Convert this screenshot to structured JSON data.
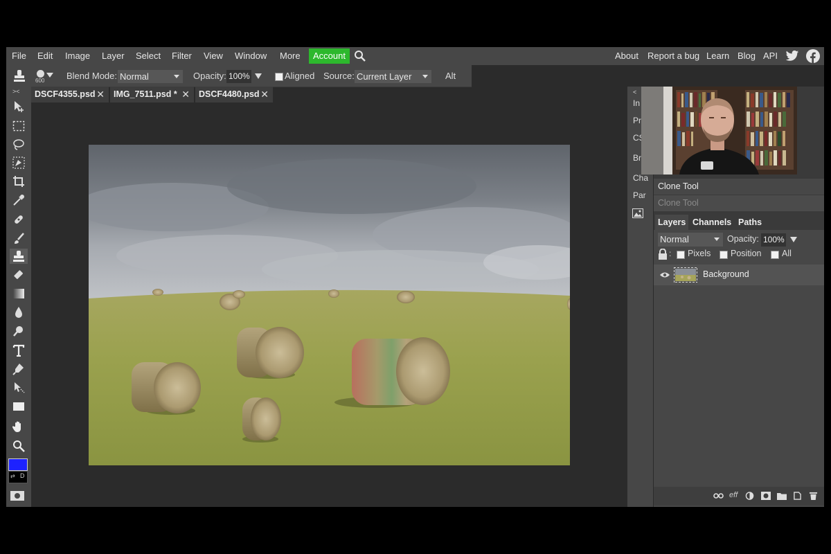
{
  "menu": {
    "items": [
      "File",
      "Edit",
      "Image",
      "Layer",
      "Select",
      "Filter",
      "View",
      "Window",
      "More"
    ],
    "account": "Account",
    "right_links": [
      "About",
      "Report a bug",
      "Learn",
      "Blog",
      "API"
    ],
    "icons": [
      "search-icon",
      "twitter-icon",
      "facebook-icon"
    ]
  },
  "options": {
    "brush_size": "600",
    "blend_label": "Blend Mode:",
    "blend_value": "Normal",
    "opacity_label": "Opacity:",
    "opacity_value": "100%",
    "aligned_label": "Aligned",
    "source_label": "Source:",
    "source_value": "Current Layer",
    "alt_label": "Alt"
  },
  "tabs": [
    {
      "label": "DSCF4355.psd"
    },
    {
      "label": "IMG_7511.psd *"
    },
    {
      "label": "DSCF4480.psd"
    }
  ],
  "mini_panel": {
    "labels": [
      "In",
      "Pr",
      "CS",
      "Br",
      "Cha",
      "Par"
    ]
  },
  "history": {
    "items": [
      "Clone Tool",
      "Clone Tool"
    ]
  },
  "layers_panel": {
    "tabs": [
      "Layers",
      "Channels",
      "Paths"
    ],
    "blend_value": "Normal",
    "opacity_label": "Opacity:",
    "opacity_value": "100%",
    "lock_pixels": "Pixels",
    "lock_position": "Position",
    "lock_all": "All",
    "layers": [
      {
        "name": "Background",
        "visible": true
      }
    ],
    "bottom_icons": [
      "link-icon",
      "effects-icon",
      "adjustment-icon",
      "mask-icon",
      "folder-icon",
      "new-layer-icon",
      "trash-icon"
    ],
    "effects_label": "eff"
  },
  "colors": {
    "accent": "#2db82d",
    "foreground_color": "#1d22ff",
    "background_color": "#000000"
  }
}
